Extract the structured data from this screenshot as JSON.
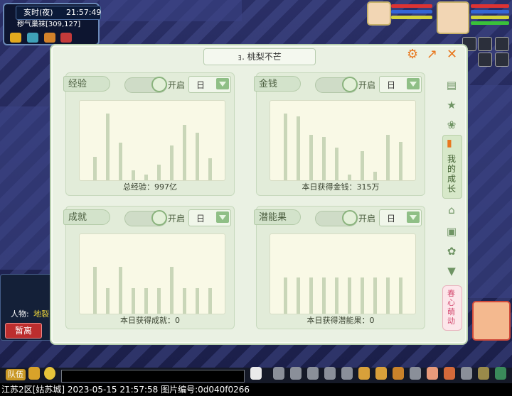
{
  "hud": {
    "time_label": "亥时(夜)",
    "clock": "21:57:49",
    "location": "秽气巢袜[309,127]"
  },
  "panel": {
    "title": "ｮ. 桃梨不芒",
    "settings_icon": "gear-icon",
    "popout_icon": "popout-icon",
    "close_icon": "close-icon"
  },
  "cards": [
    {
      "label": "经验",
      "toggle_text": "开启",
      "select": "日",
      "caption": "总经验：997亿",
      "chart": {
        "values": [
          0.32,
          0.92,
          0.52,
          0.14,
          0.08,
          0.22,
          0.48,
          0.76,
          0.66,
          0.3
        ]
      }
    },
    {
      "label": "金钱",
      "toggle_text": "开启",
      "select": "日",
      "caption": "本日获得金钱：315万",
      "chart": {
        "values": [
          0.92,
          0.88,
          0.63,
          0.6,
          0.45,
          0.08,
          0.4,
          0.12,
          0.63,
          0.53
        ]
      }
    },
    {
      "label": "成就",
      "toggle_text": "开启",
      "select": "日",
      "caption": "本日获得成就：0",
      "chart": {
        "values": [
          0.65,
          0.35,
          0.65,
          0.35,
          0.35,
          0.35,
          0.65,
          0.35,
          0.35,
          0.35
        ]
      }
    },
    {
      "label": "潜能果",
      "toggle_text": "开启",
      "select": "日",
      "caption": "本日获得潜能果：0",
      "chart": {
        "values": [
          0.5,
          0.5,
          0.5,
          0.5,
          0.5,
          0.5,
          0.5,
          0.5,
          0.5,
          0.5
        ]
      }
    }
  ],
  "side_tabs": {
    "icons": [
      "message-icon",
      "star-icon",
      "paw-icon",
      "growth-chart-icon",
      "house-icon",
      "box-icon",
      "palette-icon",
      "shirt-icon"
    ],
    "active_label": "我的成长",
    "event_label": "春心萌动"
  },
  "left_panel": {
    "row_label": "人物:",
    "row_value": "地裂",
    "leave_button": "暂离"
  },
  "bottom": {
    "team_button": "队伍"
  },
  "footer": {
    "text": "江苏2区[姑苏城] 2023-05-15 21:57:58 图片编号:0d040f0266"
  },
  "colors": {
    "panel_bg": "#eaf1e3",
    "bar": "#c9d6b8",
    "accent_orange": "#e8781f",
    "red_button": "#bc2e2e"
  }
}
